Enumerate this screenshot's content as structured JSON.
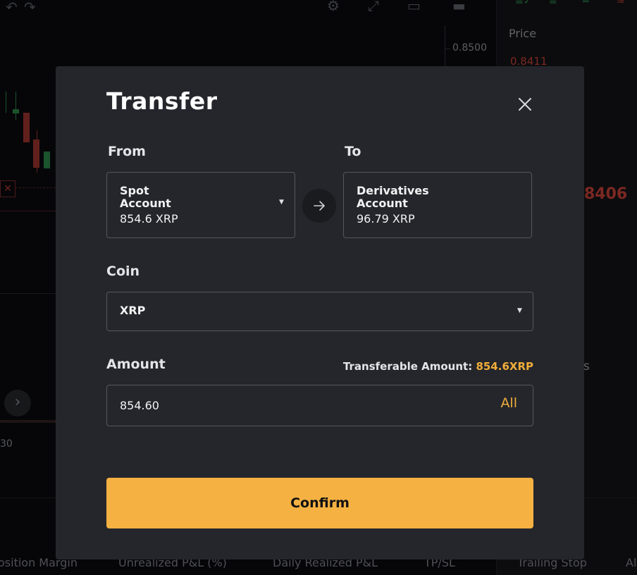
{
  "background": {
    "axis_price": "0.8500",
    "price_header": "Price",
    "price_red": "0.8411",
    "big_red_price": "8406",
    "side_text": "s",
    "bottom_left_label": "30",
    "footer_columns": [
      "osition Margin",
      "Unrealized P&L (%)",
      "Daily Realized P&L",
      "TP/SL",
      "Trailing Stop",
      "Al"
    ]
  },
  "modal": {
    "title": "Transfer",
    "from_label": "From",
    "to_label": "To",
    "from_account": {
      "name": "Spot Account",
      "balance": "854.6 XRP"
    },
    "to_account": {
      "name": "Derivatives Account",
      "balance": "96.79 XRP"
    },
    "coin_label": "Coin",
    "coin_value": "XRP",
    "amount_label": "Amount",
    "transferable_label": "Transferable Amount:",
    "transferable_amount": "854.6XRP",
    "amount_value": "854.60",
    "all_label": "All",
    "confirm_label": "Confirm"
  },
  "icons": {
    "close": "close-icon",
    "swap": "arrow-right-icon",
    "dropdown": "caret-down-icon"
  },
  "colors": {
    "accent": "#f5b142",
    "accent_text": "#f0ad3a",
    "modal_bg": "#25262b",
    "border": "#54575f",
    "down_red": "#e0493f"
  }
}
